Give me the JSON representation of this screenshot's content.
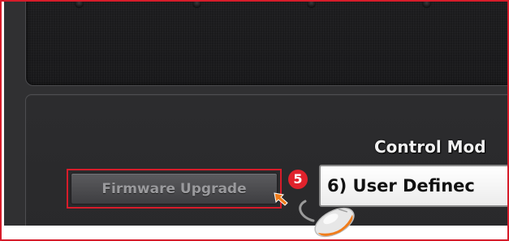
{
  "control_mode": {
    "label": "Control Mod",
    "selected_value": "6) User Definec"
  },
  "firmware": {
    "button_label": "Firmware Upgrade",
    "step_number": "5"
  },
  "icons": {
    "step_badge": "numbered-circle",
    "pointer": "orange-arrow-cursor",
    "mouse": "computer-mouse"
  },
  "colors": {
    "highlight_border": "#d61c2a",
    "badge": "#e0222c",
    "panel": "#2c2c2e",
    "cursor": "#f07c1a"
  }
}
